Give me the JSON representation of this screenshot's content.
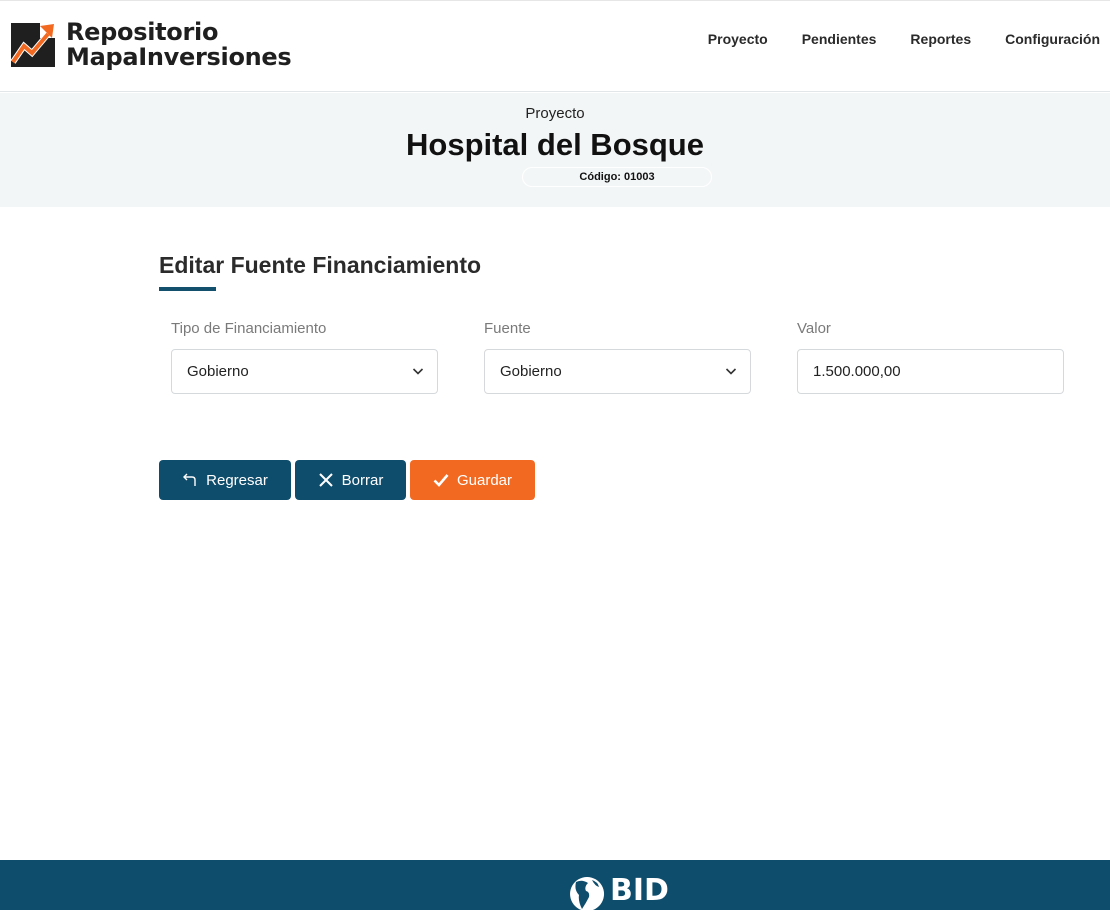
{
  "brand": {
    "line1": "Repositorio",
    "line2": "MapaInversiones",
    "logo_icon": "trend-chart-icon",
    "colors": {
      "dark": "#1f1f1f",
      "accent": "#f26a22"
    }
  },
  "nav": {
    "items": [
      "Proyecto",
      "Pendientes",
      "Reportes",
      "Configuración"
    ]
  },
  "project": {
    "kicker": "Proyecto",
    "title": "Hospital del Bosque",
    "code": "Código: 01003"
  },
  "form": {
    "title": "Editar Fuente Financiamiento",
    "fields": [
      {
        "label": "Tipo de Financiamiento",
        "value": "Gobierno",
        "type": "select"
      },
      {
        "label": "Fuente",
        "value": "Gobierno",
        "type": "select"
      },
      {
        "label": "Valor",
        "value": "1.500.000,00",
        "type": "text"
      }
    ]
  },
  "actions": {
    "back": {
      "label": "Regresar",
      "icon": "return-arrow-icon"
    },
    "delete": {
      "label": "Borrar",
      "icon": "close-icon"
    },
    "save": {
      "label": "Guardar",
      "icon": "checkmark-icon"
    }
  },
  "footer": {
    "logo_text": "BID",
    "logo_icon": "globe-icon"
  },
  "colors": {
    "primary": "#0f4d6c",
    "accent": "#f26a22",
    "banner_bg": "#f3f6f7"
  }
}
